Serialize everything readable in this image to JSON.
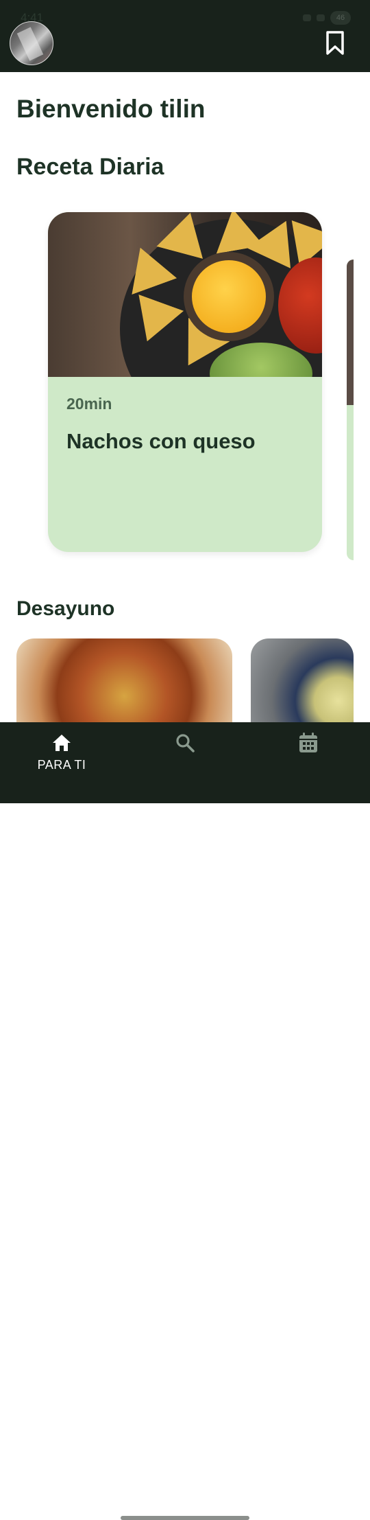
{
  "status_bar": {
    "time": "4:41",
    "battery": "46"
  },
  "header": {
    "avatar_icon": "user-avatar",
    "bookmark_icon": "bookmark-icon"
  },
  "greeting": "Bienvenido tilin",
  "daily_recipe": {
    "section_title": "Receta Diaria",
    "card": {
      "time": "20min",
      "title": "Nachos con queso",
      "accent_color": "#cfe9c8"
    }
  },
  "breakfast": {
    "section_title": "Desayuno"
  },
  "bottom_nav": {
    "items": [
      {
        "label": "PARA TI",
        "icon": "home-icon"
      },
      {
        "label": "",
        "icon": "search-icon"
      },
      {
        "label": "",
        "icon": "calendar-icon"
      }
    ]
  },
  "colors": {
    "bar_background": "#18221b",
    "text_dark": "#1e3326",
    "card_green": "#cfe9c8"
  }
}
